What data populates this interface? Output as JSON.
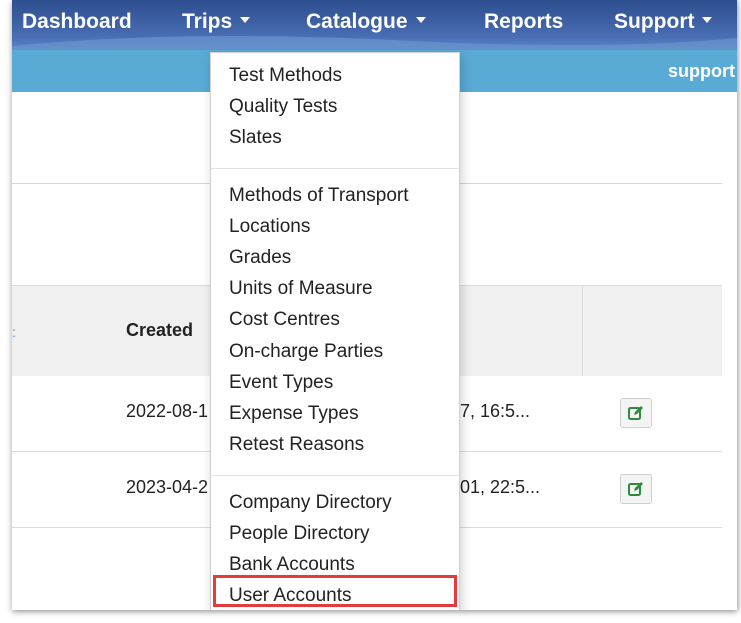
{
  "nav": {
    "items": [
      {
        "label": "Dashboard",
        "has_caret": false
      },
      {
        "label": "Trips",
        "has_caret": true
      },
      {
        "label": "Catalogue",
        "has_caret": true
      },
      {
        "label": "Reports",
        "has_caret": false
      },
      {
        "label": "Support",
        "has_caret": true
      }
    ]
  },
  "subbar": {
    "user": "support"
  },
  "table": {
    "columns": [
      "Created"
    ],
    "rows": [
      {
        "created": "2022-08-1",
        "updated": "7, 16:5..."
      },
      {
        "created": "2023-04-2",
        "updated": "01, 22:5..."
      }
    ]
  },
  "dropdown": {
    "groups": [
      [
        "Test Methods",
        "Quality Tests",
        "Slates"
      ],
      [
        "Methods of Transport",
        "Locations",
        "Grades",
        "Units of Measure",
        "Cost Centres",
        "On-charge Parties",
        "Event Types",
        "Expense Types",
        "Retest Reasons"
      ],
      [
        "Company Directory",
        "People Directory",
        "Bank Accounts",
        "User Accounts"
      ]
    ],
    "highlighted": "User Accounts"
  },
  "colors": {
    "nav_bg": "#3c5ea2",
    "subbar_bg": "#5aaad6",
    "highlight": "#e53b3b",
    "edit_icon": "#2e8b3e"
  },
  "icons": {
    "edit": "edit-icon",
    "caret": "chevron-down-icon"
  }
}
